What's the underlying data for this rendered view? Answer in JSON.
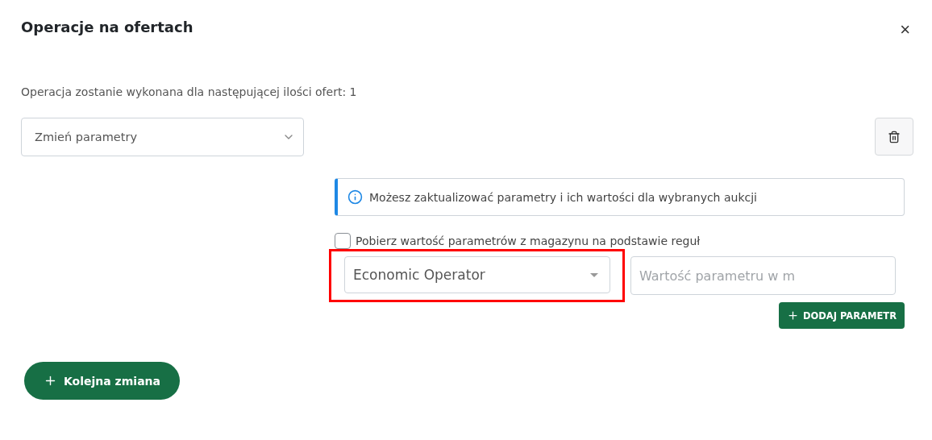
{
  "dialog": {
    "title": "Operacje na ofertach",
    "close": "×"
  },
  "summary": "Operacja zostanie wykonana dla następującej ilości ofert: 1",
  "operation_select": {
    "value": "Zmień parametry"
  },
  "info": "Możesz zaktualizować parametry i ich wartości dla wybranych aukcji",
  "warehouse_checkbox": {
    "label": "Pobierz wartość parametrów z magazynu na podstawie reguł",
    "checked": false
  },
  "parameter_row": {
    "parameter": "Economic Operator",
    "highlighted": true,
    "value_placeholder": "Wartość parametru w m"
  },
  "add_parameter_button": "DODAJ PARAMETR",
  "next_change_button": "Kolejna zmiana"
}
